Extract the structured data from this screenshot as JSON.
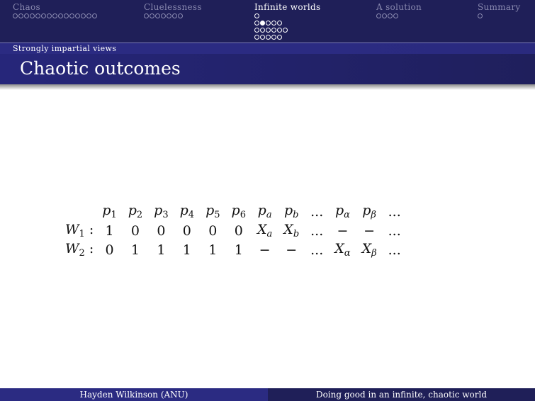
{
  "nav": {
    "sections": [
      {
        "title": "Chaos",
        "dots": [
          [
            0,
            0,
            0,
            0,
            0,
            0,
            0,
            0,
            0,
            0,
            0,
            0,
            0,
            0,
            0
          ]
        ],
        "active": false
      },
      {
        "title": "Cluelessness",
        "dots": [
          [
            0,
            0,
            0,
            0,
            0,
            0,
            0
          ]
        ],
        "active": false
      },
      {
        "title": "Infinite worlds",
        "dots": [
          [
            0
          ],
          [
            0,
            1,
            0,
            0,
            0
          ],
          [
            0,
            0,
            0,
            0,
            0,
            0
          ],
          [
            0,
            0,
            0,
            0,
            0
          ]
        ],
        "active": true
      },
      {
        "title": "A solution",
        "dots": [
          [
            0,
            0,
            0,
            0
          ]
        ],
        "active": false
      },
      {
        "title": "Summary",
        "dots": [
          [
            0
          ]
        ],
        "active": false
      }
    ]
  },
  "subsection": "Strongly impartial views",
  "frame_title": "Chaotic outcomes",
  "table": {
    "header": [
      "p1",
      "p2",
      "p3",
      "p4",
      "p5",
      "p6",
      "pa",
      "pb",
      "...",
      "pα",
      "pβ",
      "..."
    ],
    "rows": [
      {
        "label": "W1 :",
        "cells": [
          "1",
          "0",
          "0",
          "0",
          "0",
          "0",
          "Xa",
          "Xb",
          "...",
          "−",
          "−",
          "..."
        ]
      },
      {
        "label": "W2 :",
        "cells": [
          "0",
          "1",
          "1",
          "1",
          "1",
          "1",
          "−",
          "−",
          "...",
          "Xα",
          "Xβ",
          "..."
        ]
      }
    ]
  },
  "footer": {
    "author": "Hayden Wilkinson (ANU)",
    "talk_title": "Doing good in an infinite, chaotic world"
  },
  "colors": {
    "nav_bg": "#1f1f58",
    "subsection_bg": "#2b2b82",
    "title_bg": "#26267a",
    "inactive_text": "#8a8ab0"
  }
}
